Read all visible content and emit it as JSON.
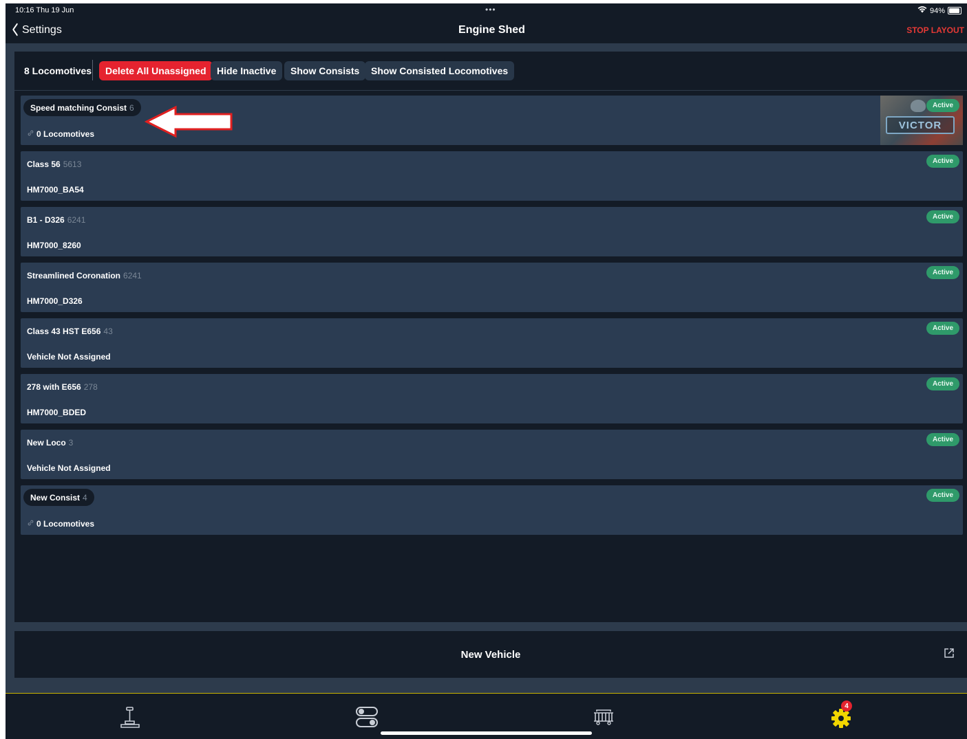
{
  "status_bar": {
    "time": "10:16  Thu 19 Jun",
    "dots": "•••",
    "battery": "94%"
  },
  "nav": {
    "back_label": "Settings",
    "title": "Engine Shed",
    "stop_label": "STOP LAYOUT"
  },
  "toolbar": {
    "count_label": "8 Locomotives",
    "delete_label": "Delete All Unassigned",
    "hide_inactive_label": "Hide Inactive",
    "show_consists_label": "Show Consists",
    "show_consisted_label": "Show Consisted Locomotives"
  },
  "rows": [
    {
      "name": "Speed matching Consist",
      "address": "6",
      "sub": "0 Locomotives",
      "status": "Active",
      "kind": "consist",
      "thumbnail_text": "VICTOR"
    },
    {
      "name": "Class 56",
      "address": "5613",
      "sub": "HM7000_BA54",
      "status": "Active",
      "kind": "loco"
    },
    {
      "name": "B1 - D326",
      "address": "6241",
      "sub": "HM7000_8260",
      "status": "Active",
      "kind": "loco"
    },
    {
      "name": "Streamlined Coronation",
      "address": "6241",
      "sub": "HM7000_D326",
      "status": "Active",
      "kind": "loco"
    },
    {
      "name": "Class 43 HST E656",
      "address": "43",
      "sub": "Vehicle Not Assigned",
      "status": "Active",
      "kind": "loco"
    },
    {
      "name": "278 with E656",
      "address": "278",
      "sub": "HM7000_BDED",
      "status": "Active",
      "kind": "loco"
    },
    {
      "name": "New Loco",
      "address": "3",
      "sub": "Vehicle Not Assigned",
      "status": "Active",
      "kind": "loco"
    },
    {
      "name": "New Consist",
      "address": "4",
      "sub": "0 Locomotives",
      "status": "Active",
      "kind": "consist"
    }
  ],
  "new_vehicle": {
    "label": "New Vehicle"
  },
  "tabs": [
    {
      "name": "throttle",
      "icon": "throttle-lever-icon"
    },
    {
      "name": "switches",
      "icon": "toggle-switches-icon"
    },
    {
      "name": "engine-shed",
      "icon": "locomotive-icon"
    },
    {
      "name": "settings",
      "icon": "gear-icon",
      "badge": "4"
    }
  ],
  "colors": {
    "accent_red": "#e5232f",
    "active_green": "#2f9a6a",
    "tabbar_line": "#c9b400",
    "settings_gear": "#f2d600"
  }
}
